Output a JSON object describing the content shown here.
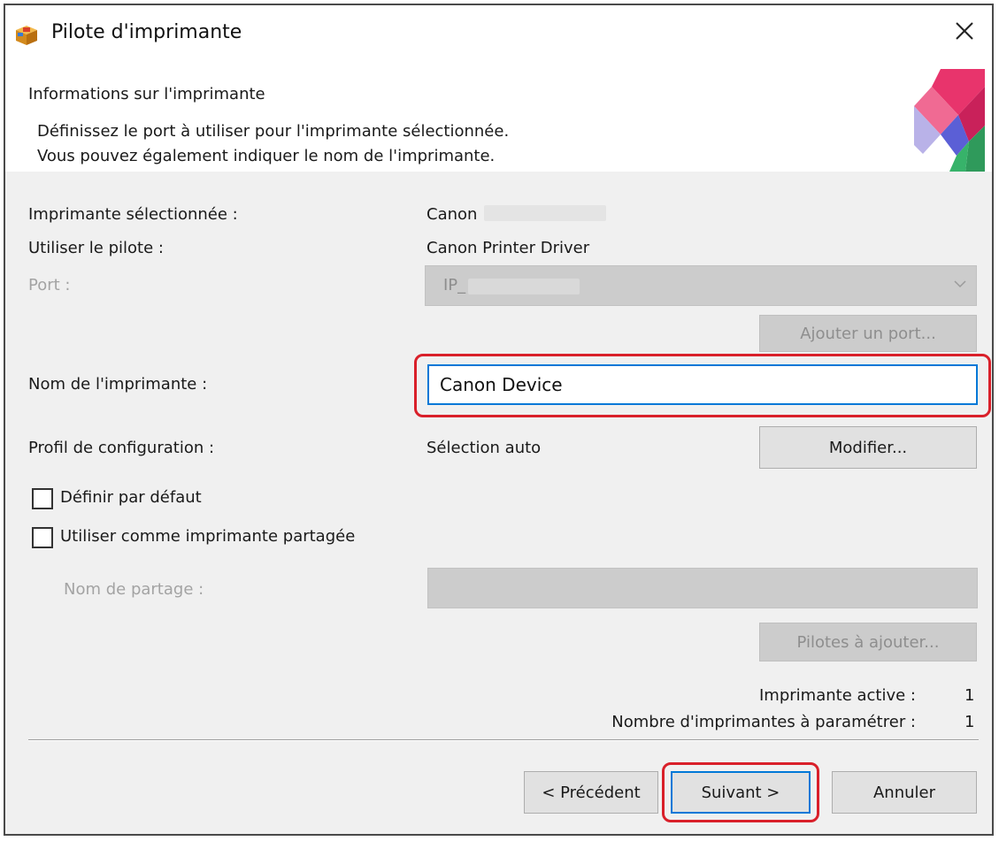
{
  "window": {
    "title": "Pilote d'imprimante"
  },
  "header": {
    "title": "Informations sur l'imprimante",
    "desc_line1": "Définissez le port à utiliser pour l'imprimante sélectionnée.",
    "desc_line2": "Vous pouvez également indiquer le nom de l'imprimante."
  },
  "form": {
    "selected_printer_label": "Imprimante sélectionnée :",
    "selected_printer_value": "Canon",
    "driver_label": "Utiliser le pilote :",
    "driver_value": "Canon Printer Driver",
    "port_label": "Port :",
    "port_value": "IP_",
    "add_port_button": "Ajouter un port...",
    "printer_name_label": "Nom de l'imprimante :",
    "printer_name_value": "Canon Device",
    "config_profile_label": "Profil de configuration :",
    "config_profile_value": "Sélection auto",
    "modify_button": "Modifier...",
    "set_default_label": "Définir par défaut",
    "set_default_checked": false,
    "shared_label": "Utiliser comme imprimante partagée",
    "shared_checked": false,
    "share_name_label": "Nom de partage :",
    "share_name_value": "",
    "add_drivers_button": "Pilotes à ajouter...",
    "active_printer_label": "Imprimante active :",
    "active_printer_value": "1",
    "printer_count_label": "Nombre d'imprimantes à paramétrer :",
    "printer_count_value": "1"
  },
  "footer": {
    "previous_button": "< Précédent",
    "next_button": "Suivant >",
    "cancel_button": "Annuler"
  },
  "colors": {
    "highlight_red": "#d9202a",
    "focus_blue": "#0078d7",
    "body_bg": "#f0f0f0"
  },
  "icons": {
    "app": "printer-driver-box-icon",
    "close": "close-icon",
    "dropdown": "chevron-down-icon"
  }
}
